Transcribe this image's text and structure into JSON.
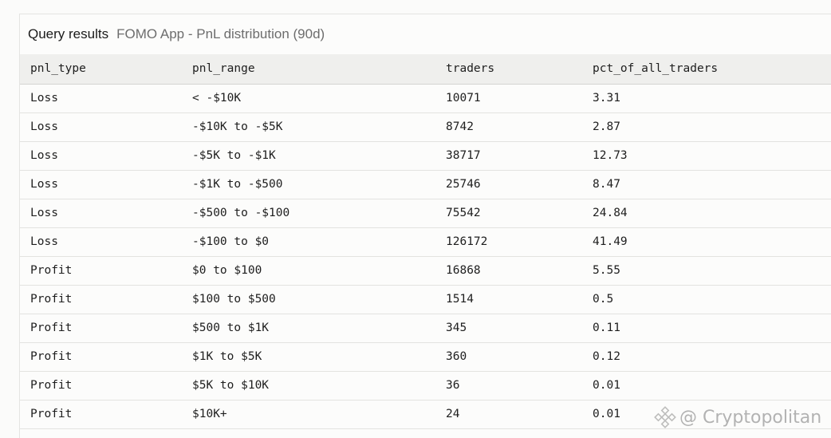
{
  "header": {
    "title": "Query results",
    "subtitle": "FOMO App - PnL distribution (90d)"
  },
  "table": {
    "columns": [
      "pnl_type",
      "pnl_range",
      "traders",
      "pct_of_all_traders"
    ],
    "rows": [
      [
        "Loss",
        "< -$10K",
        "10071",
        "3.31"
      ],
      [
        "Loss",
        "-$10K to -$5K",
        "8742",
        "2.87"
      ],
      [
        "Loss",
        "-$5K to -$1K",
        "38717",
        "12.73"
      ],
      [
        "Loss",
        "-$1K to -$500",
        "25746",
        "8.47"
      ],
      [
        "Loss",
        "-$500 to -$100",
        "75542",
        "24.84"
      ],
      [
        "Loss",
        "-$100 to $0",
        "126172",
        "41.49"
      ],
      [
        "Profit",
        "$0 to $100",
        "16868",
        "5.55"
      ],
      [
        "Profit",
        "$100 to $500",
        "1514",
        "0.5"
      ],
      [
        "Profit",
        "$500 to $1K",
        "345",
        "0.11"
      ],
      [
        "Profit",
        "$1K to $5K",
        "360",
        "0.12"
      ],
      [
        "Profit",
        "$5K to $10K",
        "36",
        "0.01"
      ],
      [
        "Profit",
        "$10K+",
        "24",
        "0.01"
      ]
    ]
  },
  "watermark": {
    "text": "@ Cryptopolitan",
    "icon": "binance-logo-icon"
  }
}
